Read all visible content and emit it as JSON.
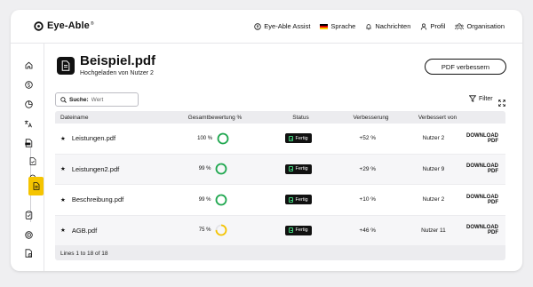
{
  "app": {
    "name": "Eye-Able",
    "trademark": "®"
  },
  "nav": {
    "assist": "Eye-Able Assist",
    "language": "Sprache",
    "notifications": "Nachrichten",
    "profile": "Profil",
    "organisation": "Organisation"
  },
  "file": {
    "title": "Beispiel.pdf",
    "subtitle": "Hochgeladen von Nutzer 2"
  },
  "actions": {
    "improve": "PDF verbessern",
    "filter": "Filter"
  },
  "search": {
    "label": "Suche:",
    "placeholder": "Wert"
  },
  "table": {
    "headers": {
      "name": "Dateiname",
      "score": "Gesamtbewertung %",
      "status": "Status",
      "improvement": "Verbesserung",
      "improved_by": "Verbessert von"
    },
    "rows": [
      {
        "name": "Leistungen.pdf",
        "score": 100,
        "score_label": "100 %",
        "status": "Fertig",
        "improvement": "+52 %",
        "by": "Nutzer 2",
        "download": "DOWNLOAD PDF"
      },
      {
        "name": "Leistungen2.pdf",
        "score": 99,
        "score_label": "99 %",
        "status": "Fertig",
        "improvement": "+29 %",
        "by": "Nutzer 9",
        "download": "DOWNLOAD PDF"
      },
      {
        "name": "Beschreibung.pdf",
        "score": 99,
        "score_label": "99 %",
        "status": "Fertig",
        "improvement": "+10 %",
        "by": "Nutzer 2",
        "download": "DOWNLOAD PDF"
      },
      {
        "name": "AGB.pdf",
        "score": 75,
        "score_label": "75 %",
        "status": "Fertig",
        "improvement": "+46 %",
        "by": "Nutzer 11",
        "download": "DOWNLOAD PDF"
      }
    ],
    "footer": "Lines 1 to 18 of 18"
  },
  "colors": {
    "accent": "#f5c400",
    "success": "#1fa84f",
    "warning": "#f5c400",
    "dark": "#111111"
  },
  "icons": {
    "sidebar": [
      "home-icon",
      "coin-icon",
      "pie-chart-icon",
      "translate-icon",
      "pdf-icon",
      "document-check-icon",
      "document-search-icon",
      "document-active-icon",
      "clipboard-icon",
      "target-icon",
      "report-icon"
    ]
  }
}
